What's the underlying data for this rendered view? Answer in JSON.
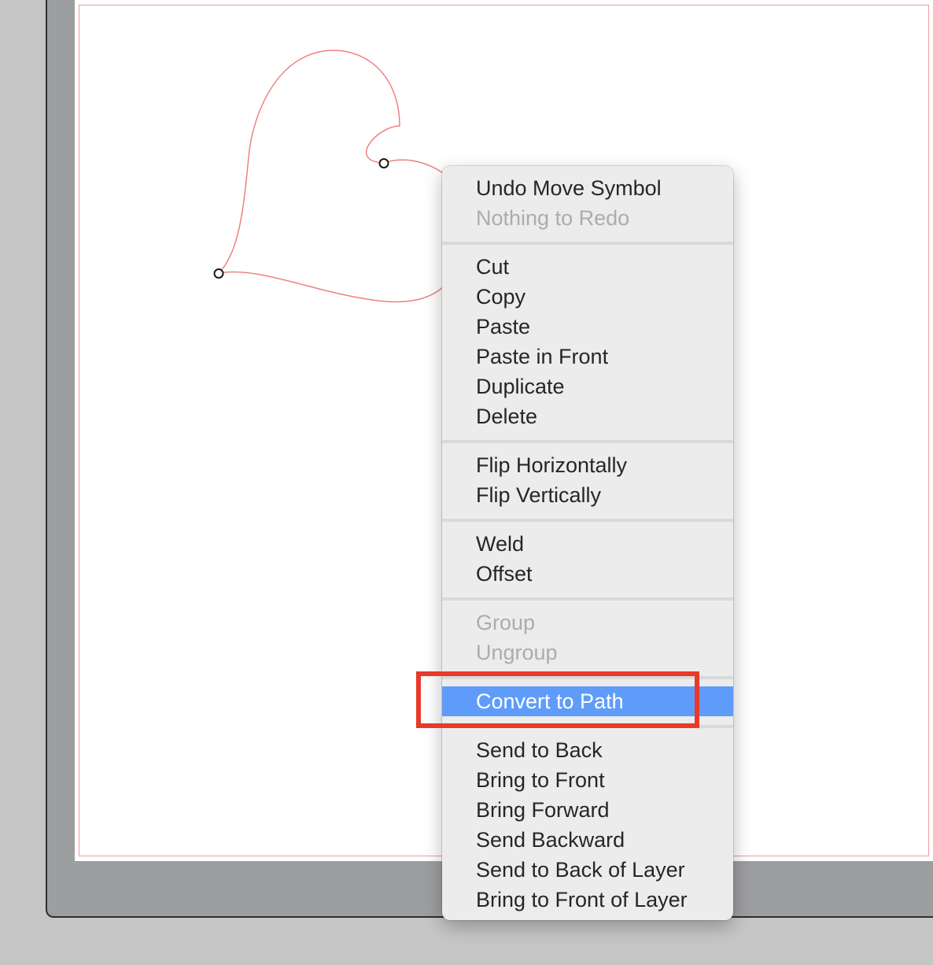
{
  "context_menu": {
    "groups": [
      [
        {
          "label": "Undo Move Symbol",
          "enabled": true
        },
        {
          "label": "Nothing to Redo",
          "enabled": false
        }
      ],
      [
        {
          "label": "Cut",
          "enabled": true
        },
        {
          "label": "Copy",
          "enabled": true
        },
        {
          "label": "Paste",
          "enabled": true
        },
        {
          "label": "Paste in Front",
          "enabled": true
        },
        {
          "label": "Duplicate",
          "enabled": true
        },
        {
          "label": "Delete",
          "enabled": true
        }
      ],
      [
        {
          "label": "Flip Horizontally",
          "enabled": true
        },
        {
          "label": "Flip Vertically",
          "enabled": true
        }
      ],
      [
        {
          "label": "Weld",
          "enabled": true
        },
        {
          "label": "Offset",
          "enabled": true
        }
      ],
      [
        {
          "label": "Group",
          "enabled": false
        },
        {
          "label": "Ungroup",
          "enabled": false
        }
      ],
      [
        {
          "label": "Convert to Path",
          "enabled": true,
          "highlighted": true
        }
      ],
      [
        {
          "label": "Send to Back",
          "enabled": true
        },
        {
          "label": "Bring to Front",
          "enabled": true
        },
        {
          "label": "Bring Forward",
          "enabled": true
        },
        {
          "label": "Send Backward",
          "enabled": true
        },
        {
          "label": "Send to Back of Layer",
          "enabled": true
        },
        {
          "label": "Bring to Front of Layer",
          "enabled": true
        }
      ]
    ]
  },
  "colors": {
    "highlight_bg": "#5f9cf9",
    "annotation_box": "#e8392a",
    "shape_stroke": "#f08080",
    "page_margin": "#f59a9a"
  }
}
